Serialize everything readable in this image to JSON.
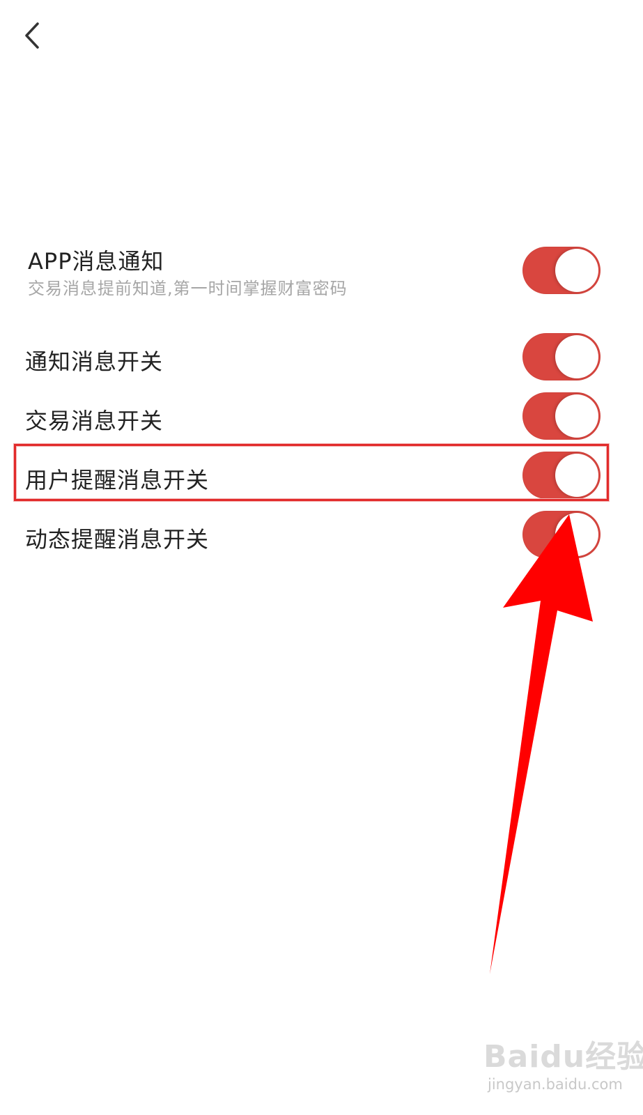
{
  "header": {
    "back_icon": "chevron-left-icon"
  },
  "settings": {
    "app_notification": {
      "title": "APP消息通知",
      "subtitle": "交易消息提前知道,第一时间掌握财富密码",
      "enabled": true
    },
    "items": [
      {
        "label": "通知消息开关",
        "enabled": true
      },
      {
        "label": "交易消息开关",
        "enabled": true
      },
      {
        "label": "用户提醒消息开关",
        "enabled": true
      },
      {
        "label": "动态提醒消息开关",
        "enabled": true
      }
    ]
  },
  "colors": {
    "toggle_on": "#d9463f",
    "annotation_red": "#ff0000"
  },
  "watermark": {
    "logo_text": "Baidu经验",
    "url": "jingyan.baidu.com"
  }
}
